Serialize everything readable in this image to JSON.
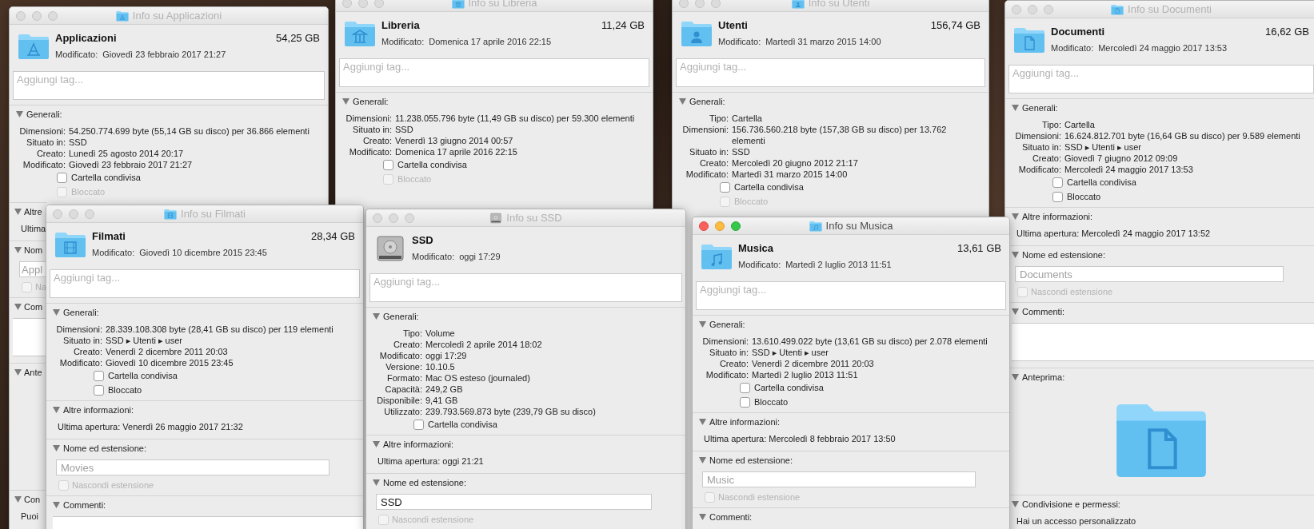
{
  "windows": [
    {
      "title": "Info su Applicazioni",
      "active": false,
      "name": "Applicazioni",
      "size": "54,25 GB",
      "modified_label": "Modificato:",
      "modified": "Giovedì 23 febbraio 2017 21:27",
      "tags_placeholder": "Aggiungi tag...",
      "sections": [
        {
          "title": "Generali:",
          "expanded": true,
          "kind": "info",
          "items": [
            {
              "kind": "row",
              "label": "Dimensioni:",
              "value": "54.250.774.699 byte (55,14 GB su disco) per 36.866 elementi"
            },
            {
              "kind": "row",
              "label": "Situato in:",
              "value": "SSD"
            },
            {
              "kind": "row",
              "label": "Creato:",
              "value": "Lunedì 25 agosto 2014 20:17"
            },
            {
              "kind": "row",
              "label": "Modificato:",
              "value": "Giovedì 23 febbraio 2017 21:27"
            },
            {
              "kind": "checkbox",
              "label": "Cartella condivisa",
              "checked": false,
              "disabled": false
            },
            {
              "kind": "checkbox",
              "label": "Bloccato",
              "checked": false,
              "disabled": true
            }
          ]
        },
        {
          "title": "Altre",
          "expanded": true,
          "kind": "info",
          "items": [
            {
              "kind": "line",
              "text": "Ultima"
            }
          ]
        },
        {
          "title": "Nom",
          "expanded": true,
          "kind": "info",
          "items": [
            {
              "kind": "field",
              "value": "Appl",
              "disabled": true
            },
            {
              "kind": "checkbox",
              "label": "Na",
              "checked": false,
              "disabled": true
            }
          ]
        },
        {
          "title": "Com",
          "expanded": true,
          "kind": "info",
          "items": [
            {
              "kind": "comments"
            }
          ]
        },
        {
          "title": "Ante",
          "expanded": true,
          "kind": "preview"
        },
        {
          "title": "Con",
          "expanded": true,
          "kind": "info",
          "items": [
            {
              "kind": "line",
              "text": "Puoi"
            }
          ]
        }
      ]
    },
    {
      "title": "Info su Libreria",
      "active": false,
      "name": "Libreria",
      "size": "11,24 GB",
      "modified_label": "Modificato:",
      "modified": "Domenica 17 aprile 2016 22:15",
      "tags_placeholder": "Aggiungi tag...",
      "sections": [
        {
          "title": "Generali:",
          "expanded": true,
          "kind": "info",
          "items": [
            {
              "kind": "row",
              "label": "Dimensioni:",
              "value": "11.238.055.796 byte (11,49 GB su disco) per 59.300 elementi"
            },
            {
              "kind": "row",
              "label": "Situato in:",
              "value": "SSD"
            },
            {
              "kind": "row",
              "label": "Creato:",
              "value": "Venerdì 13 giugno 2014 00:57"
            },
            {
              "kind": "row",
              "label": "Modificato:",
              "value": "Domenica 17 aprile 2016 22:15"
            },
            {
              "kind": "checkbox",
              "label": "Cartella condivisa",
              "checked": false,
              "disabled": false
            },
            {
              "kind": "checkbox",
              "label": "Bloccato",
              "checked": false,
              "disabled": true
            }
          ]
        }
      ]
    },
    {
      "title": "Info su Utenti",
      "active": false,
      "name": "Utenti",
      "size": "156,74 GB",
      "modified_label": "Modificato:",
      "modified": "Martedì 31 marzo 2015 14:00",
      "tags_placeholder": "Aggiungi tag...",
      "sections": [
        {
          "title": "Generali:",
          "expanded": true,
          "kind": "info",
          "items": [
            {
              "kind": "row",
              "label": "Tipo:",
              "value": "Cartella"
            },
            {
              "kind": "row",
              "label": "Dimensioni:",
              "value": "156.736.560.218 byte (157,38 GB su disco) per 13.762 elementi"
            },
            {
              "kind": "row",
              "label": "Situato in:",
              "value": "SSD"
            },
            {
              "kind": "row",
              "label": "Creato:",
              "value": "Mercoledì 20 giugno 2012 21:17"
            },
            {
              "kind": "row",
              "label": "Modificato:",
              "value": "Martedì 31 marzo 2015 14:00"
            },
            {
              "kind": "checkbox",
              "label": "Cartella condivisa",
              "checked": false,
              "disabled": false
            },
            {
              "kind": "checkbox",
              "label": "Bloccato",
              "checked": false,
              "disabled": true
            }
          ]
        }
      ]
    },
    {
      "title": "Info su Documenti",
      "active": false,
      "name": "Documenti",
      "size": "16,62 GB",
      "modified_label": "Modificato:",
      "modified": "Mercoledì 24 maggio 2017 13:53",
      "tags_placeholder": "Aggiungi tag...",
      "sections": [
        {
          "title": "Generali:",
          "expanded": true,
          "kind": "info",
          "items": [
            {
              "kind": "row",
              "label": "Tipo:",
              "value": "Cartella"
            },
            {
              "kind": "row",
              "label": "Dimensioni:",
              "value": "16.624.812.701 byte (16,64 GB su disco) per 9.589 elementi"
            },
            {
              "kind": "row",
              "label": "Situato in:",
              "value": "SSD ▸ Utenti ▸ user"
            },
            {
              "kind": "row",
              "label": "Creato:",
              "value": "Giovedì 7 giugno 2012 09:09"
            },
            {
              "kind": "row",
              "label": "Modificato:",
              "value": "Mercoledì 24 maggio 2017 13:53"
            },
            {
              "kind": "checkbox",
              "label": "Cartella condivisa",
              "checked": false,
              "disabled": false
            },
            {
              "kind": "checkbox",
              "label": "Bloccato",
              "checked": false,
              "disabled": false
            }
          ]
        },
        {
          "title": "Altre informazioni:",
          "expanded": true,
          "kind": "info",
          "items": [
            {
              "kind": "line",
              "text": "Ultima apertura: Mercoledì 24 maggio 2017 13:52"
            }
          ]
        },
        {
          "title": "Nome ed estensione:",
          "expanded": true,
          "kind": "info",
          "items": [
            {
              "kind": "field",
              "value": "Documents",
              "disabled": true
            },
            {
              "kind": "checkbox",
              "label": "Nascondi estensione",
              "checked": false,
              "disabled": true
            }
          ]
        },
        {
          "title": "Commenti:",
          "expanded": true,
          "kind": "info",
          "items": [
            {
              "kind": "comments"
            }
          ]
        },
        {
          "title": "Anteprima:",
          "expanded": true,
          "kind": "preview",
          "items": [
            {
              "kind": "preview-icon"
            }
          ]
        },
        {
          "title": "Condivisione e permessi:",
          "expanded": true,
          "kind": "info",
          "items": [
            {
              "kind": "line",
              "text": "Hai un accesso personalizzato"
            }
          ]
        }
      ]
    },
    {
      "title": "Info su Filmati",
      "active": false,
      "name": "Filmati",
      "size": "28,34 GB",
      "modified_label": "Modificato:",
      "modified": "Giovedì 10 dicembre 2015 23:45",
      "tags_placeholder": "Aggiungi tag...",
      "sections": [
        {
          "title": "Generali:",
          "expanded": true,
          "kind": "info",
          "items": [
            {
              "kind": "row",
              "label": "Dimensioni:",
              "value": "28.339.108.308 byte (28,41 GB su disco) per 119 elementi"
            },
            {
              "kind": "row",
              "label": "Situato in:",
              "value": "SSD ▸ Utenti ▸ user"
            },
            {
              "kind": "row",
              "label": "Creato:",
              "value": "Venerdì 2 dicembre 2011 20:03"
            },
            {
              "kind": "row",
              "label": "Modificato:",
              "value": "Giovedì 10 dicembre 2015 23:45"
            },
            {
              "kind": "checkbox",
              "label": "Cartella condivisa",
              "checked": false,
              "disabled": false
            },
            {
              "kind": "checkbox",
              "label": "Bloccato",
              "checked": false,
              "disabled": false
            }
          ]
        },
        {
          "title": "Altre informazioni:",
          "expanded": true,
          "kind": "info",
          "items": [
            {
              "kind": "line",
              "text": "Ultima apertura: Venerdì 26 maggio 2017 21:32"
            }
          ]
        },
        {
          "title": "Nome ed estensione:",
          "expanded": true,
          "kind": "info",
          "items": [
            {
              "kind": "field",
              "value": "Movies",
              "disabled": true
            },
            {
              "kind": "checkbox",
              "label": "Nascondi estensione",
              "checked": false,
              "disabled": true
            }
          ]
        },
        {
          "title": "Commenti:",
          "expanded": true,
          "kind": "info",
          "items": [
            {
              "kind": "comments"
            }
          ]
        }
      ]
    },
    {
      "title": "Info su SSD",
      "active": false,
      "name": "SSD",
      "modified_label": "Modificato:",
      "modified": "oggi 17:29",
      "tags_placeholder": "Aggiungi tag...",
      "sections": [
        {
          "title": "Generali:",
          "expanded": true,
          "kind": "info",
          "items": [
            {
              "kind": "row",
              "label": "Tipo:",
              "value": "Volume"
            },
            {
              "kind": "row",
              "label": "Creato:",
              "value": "Mercoledì 2 aprile 2014 18:02"
            },
            {
              "kind": "row",
              "label": "Modificato:",
              "value": "oggi 17:29"
            },
            {
              "kind": "row",
              "label": "Versione:",
              "value": "10.10.5"
            },
            {
              "kind": "row",
              "label": "Formato:",
              "value": "Mac OS esteso (journaled)"
            },
            {
              "kind": "row",
              "label": "Capacità:",
              "value": "249,2 GB"
            },
            {
              "kind": "row",
              "label": "Disponibile:",
              "value": "9,41 GB"
            },
            {
              "kind": "row",
              "label": "Utilizzato:",
              "value": "239.793.569.873 byte (239,79 GB su disco)"
            },
            {
              "kind": "checkbox",
              "label": "Cartella condivisa",
              "checked": false,
              "disabled": false
            }
          ]
        },
        {
          "title": "Altre informazioni:",
          "expanded": true,
          "kind": "info",
          "items": [
            {
              "kind": "line",
              "text": "Ultima apertura: oggi 21:21"
            }
          ]
        },
        {
          "title": "Nome ed estensione:",
          "expanded": true,
          "kind": "info",
          "items": [
            {
              "kind": "field",
              "value": "SSD",
              "disabled": false
            },
            {
              "kind": "checkbox",
              "label": "Nascondi estensione",
              "checked": false,
              "disabled": true
            }
          ]
        }
      ]
    },
    {
      "title": "Info su Musica",
      "active": true,
      "name": "Musica",
      "size": "13,61 GB",
      "modified_label": "Modificato:",
      "modified": "Martedì 2 luglio 2013 11:51",
      "tags_placeholder": "Aggiungi tag...",
      "sections": [
        {
          "title": "Generali:",
          "expanded": true,
          "kind": "info",
          "items": [
            {
              "kind": "row",
              "label": "Dimensioni:",
              "value": "13.610.499.022 byte (13,61 GB su disco) per 2.078 elementi"
            },
            {
              "kind": "row",
              "label": "Situato in:",
              "value": "SSD ▸ Utenti ▸ user"
            },
            {
              "kind": "row",
              "label": "Creato:",
              "value": "Venerdì 2 dicembre 2011 20:03"
            },
            {
              "kind": "row",
              "label": "Modificato:",
              "value": "Martedì 2 luglio 2013 11:51"
            },
            {
              "kind": "checkbox",
              "label": "Cartella condivisa",
              "checked": false,
              "disabled": false
            },
            {
              "kind": "checkbox",
              "label": "Bloccato",
              "checked": false,
              "disabled": false
            }
          ]
        },
        {
          "title": "Altre informazioni:",
          "expanded": true,
          "kind": "info",
          "items": [
            {
              "kind": "line",
              "text": "Ultima apertura: Mercoledì 8 febbraio 2017 13:50"
            }
          ]
        },
        {
          "title": "Nome ed estensione:",
          "expanded": true,
          "kind": "info",
          "items": [
            {
              "kind": "field",
              "value": "Music",
              "disabled": true
            },
            {
              "kind": "checkbox",
              "label": "Nascondi estensione",
              "checked": false,
              "disabled": true
            }
          ]
        },
        {
          "title": "Commenti:",
          "expanded": true,
          "kind": "info"
        }
      ]
    }
  ]
}
